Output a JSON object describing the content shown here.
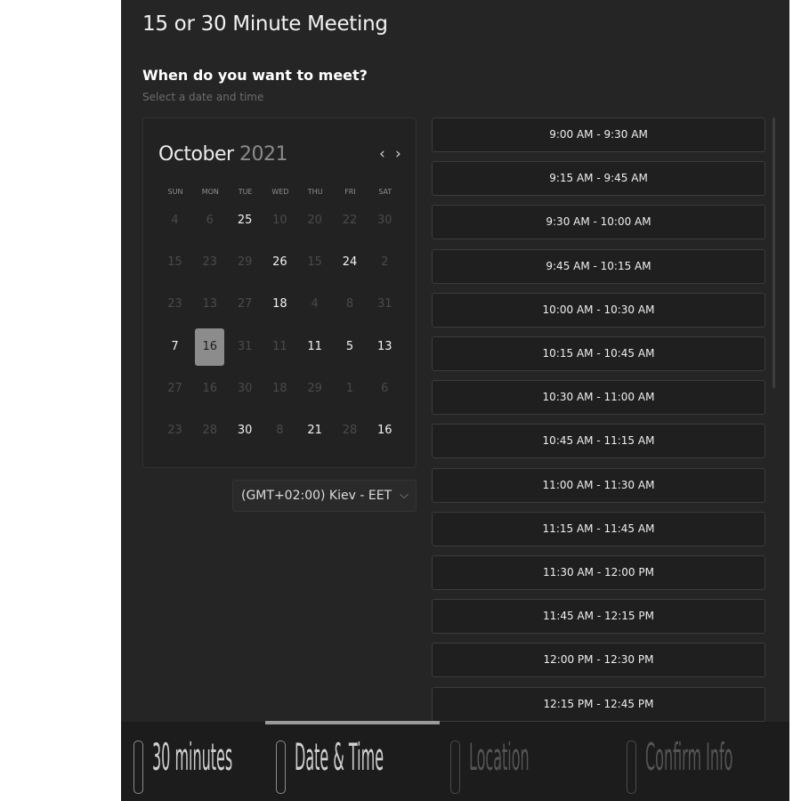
{
  "header": {
    "title": "15 or 30 Minute Meeting",
    "question": "When do you want to meet?",
    "subtitle": "Select a date and time"
  },
  "calendar": {
    "month": "October",
    "year": "2021",
    "prev_icon": "chevron-left-icon",
    "next_icon": "chevron-right-icon",
    "prev_glyph": "‹",
    "next_glyph": "›",
    "weekdays": [
      "SUN",
      "MON",
      "TUE",
      "WED",
      "THU",
      "FRI",
      "SAT"
    ],
    "weeks": [
      [
        {
          "d": "4",
          "s": "unavailable"
        },
        {
          "d": "6",
          "s": "unavailable"
        },
        {
          "d": "25",
          "s": "available"
        },
        {
          "d": "10",
          "s": "unavailable"
        },
        {
          "d": "20",
          "s": "unavailable"
        },
        {
          "d": "22",
          "s": "unavailable"
        },
        {
          "d": "30",
          "s": "unavailable"
        }
      ],
      [
        {
          "d": "15",
          "s": "unavailable"
        },
        {
          "d": "23",
          "s": "unavailable"
        },
        {
          "d": "29",
          "s": "unavailable"
        },
        {
          "d": "26",
          "s": "available"
        },
        {
          "d": "15",
          "s": "unavailable"
        },
        {
          "d": "24",
          "s": "available"
        },
        {
          "d": "2",
          "s": "unavailable"
        }
      ],
      [
        {
          "d": "23",
          "s": "unavailable"
        },
        {
          "d": "13",
          "s": "unavailable"
        },
        {
          "d": "27",
          "s": "unavailable"
        },
        {
          "d": "18",
          "s": "available"
        },
        {
          "d": "4",
          "s": "unavailable"
        },
        {
          "d": "8",
          "s": "unavailable"
        },
        {
          "d": "31",
          "s": "unavailable"
        }
      ],
      [
        {
          "d": "7",
          "s": "available"
        },
        {
          "d": "16",
          "s": "selected"
        },
        {
          "d": "31",
          "s": "unavailable"
        },
        {
          "d": "11",
          "s": "unavailable"
        },
        {
          "d": "11",
          "s": "available"
        },
        {
          "d": "5",
          "s": "available"
        },
        {
          "d": "13",
          "s": "available"
        }
      ],
      [
        {
          "d": "27",
          "s": "unavailable"
        },
        {
          "d": "16",
          "s": "unavailable"
        },
        {
          "d": "30",
          "s": "unavailable"
        },
        {
          "d": "18",
          "s": "unavailable"
        },
        {
          "d": "29",
          "s": "unavailable"
        },
        {
          "d": "1",
          "s": "unavailable"
        },
        {
          "d": "6",
          "s": "unavailable"
        }
      ],
      [
        {
          "d": "23",
          "s": "unavailable"
        },
        {
          "d": "28",
          "s": "unavailable"
        },
        {
          "d": "30",
          "s": "available"
        },
        {
          "d": "8",
          "s": "unavailable"
        },
        {
          "d": "21",
          "s": "available"
        },
        {
          "d": "28",
          "s": "unavailable"
        },
        {
          "d": "16",
          "s": "available"
        }
      ]
    ]
  },
  "timezone": {
    "label": "(GMT+02:00) Kiev - EET",
    "icon": "chevron-down-icon",
    "glyph": "⌵"
  },
  "slots": [
    "9:00 AM - 9:30 AM",
    "9:15 AM - 9:45 AM",
    "9:30 AM - 10:00 AM",
    "9:45 AM - 10:15 AM",
    "10:00 AM - 10:30 AM",
    "10:15 AM - 10:45 AM",
    "10:30 AM - 11:00 AM",
    "10:45 AM - 11:15 AM",
    "11:00 AM - 11:30 AM",
    "11:15 AM - 11:45 AM",
    "11:30 AM - 12:00 PM",
    "11:45 AM - 12:15 PM",
    "12:00 PM - 12:30 PM",
    "12:15 PM - 12:45 PM"
  ],
  "steps": [
    {
      "label": "30 minutes",
      "state": "done",
      "icon": "clock-icon"
    },
    {
      "label": "Date & Time",
      "state": "current",
      "icon": "calendar-icon"
    },
    {
      "label": "Location",
      "state": "upcoming",
      "icon": "location-pin-icon"
    },
    {
      "label": "Confirm Info",
      "state": "upcoming",
      "icon": "checkbox-icon"
    }
  ],
  "colors": {
    "panel_bg": "#252525",
    "selected_day": "#8c8c8c",
    "text_primary": "#f2f2f2",
    "text_muted": "#6c6c6c"
  }
}
